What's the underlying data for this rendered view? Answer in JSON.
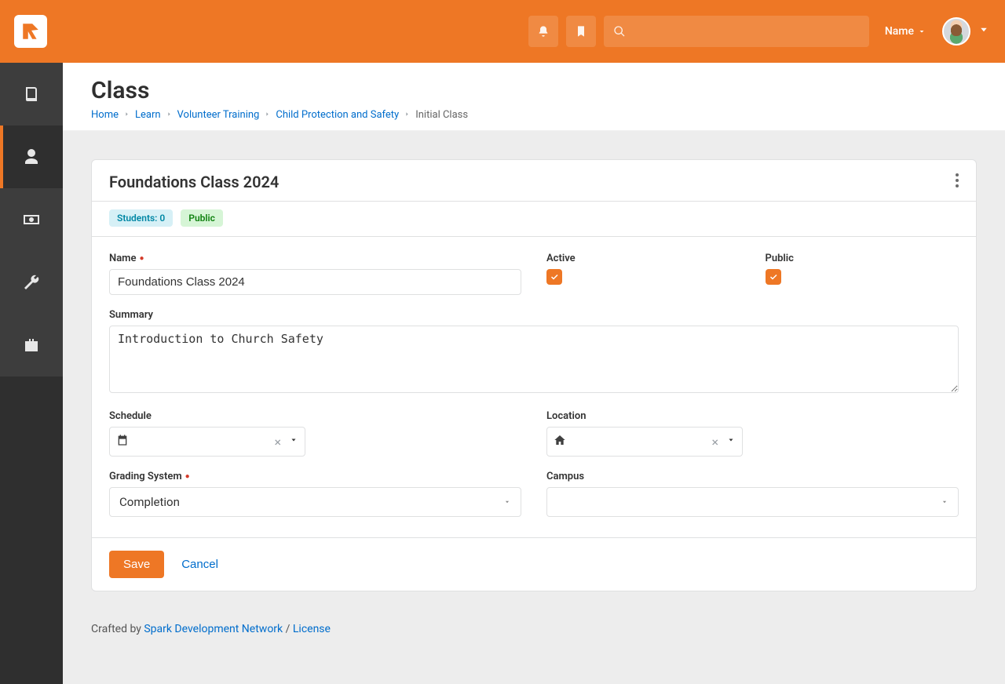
{
  "header": {
    "username": "Name"
  },
  "page": {
    "title": "Class",
    "breadcrumbs": {
      "home": "Home",
      "learn": "Learn",
      "vol": "Volunteer Training",
      "child": "Child Protection and Safety",
      "current": "Initial Class"
    }
  },
  "panel": {
    "title": "Foundations Class 2024",
    "badges": {
      "students": "Students: 0",
      "public": "Public"
    },
    "labels": {
      "name": "Name",
      "active": "Active",
      "public": "Public",
      "summary": "Summary",
      "schedule": "Schedule",
      "location": "Location",
      "grading": "Grading System",
      "campus": "Campus"
    },
    "values": {
      "name": "Foundations Class 2024",
      "summary": "Introduction to Church Safety",
      "grading": "Completion",
      "campus": "",
      "active": true,
      "public": true
    },
    "actions": {
      "save": "Save",
      "cancel": "Cancel"
    }
  },
  "footer": {
    "crafted": "Crafted by ",
    "spark": "Spark Development Network",
    "sep": " / ",
    "license": "License"
  }
}
